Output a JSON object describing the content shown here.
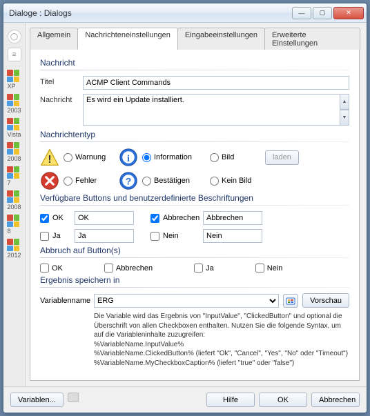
{
  "window": {
    "title": "Dialoge : Dialogs"
  },
  "tabs": [
    "Allgemein",
    "Nachrichteneinstellungen",
    "Eingabeeinstellungen",
    "Erweiterte Einstellungen"
  ],
  "activeTab": 1,
  "osList": [
    "XP",
    "2003",
    "Vista",
    "2008",
    "7",
    "2008",
    "8",
    "2012"
  ],
  "section": {
    "nachricht": "Nachricht",
    "typ": "Nachrichtentyp",
    "buttons": "Verfügbare Buttons und benutzerdefinierte Beschriftungen",
    "abbruch": "Abbruch auf Button(s)",
    "ergebnis": "Ergebnis speichern in"
  },
  "labels": {
    "titel": "Titel",
    "nachricht": "Nachricht",
    "variablenname": "Variablenname"
  },
  "values": {
    "titel": "ACMP Client Commands",
    "nachricht": "Es wird ein Update installiert."
  },
  "msgtype": {
    "warnung": "Warnung",
    "information": "Information",
    "fehler": "Fehler",
    "bestaetigen": "Bestätigen",
    "bild": "Bild",
    "keinbild": "Kein Bild",
    "laden": "laden",
    "selected": "information"
  },
  "avbuttons": {
    "ok": {
      "label": "OK",
      "checked": true,
      "value": "OK"
    },
    "abbrechen": {
      "label": "Abbrechen",
      "checked": true,
      "value": "Abbrechen"
    },
    "ja": {
      "label": "Ja",
      "checked": false,
      "value": "Ja"
    },
    "nein": {
      "label": "Nein",
      "checked": false,
      "value": "Nein"
    }
  },
  "cancelOn": {
    "ok": {
      "label": "OK",
      "checked": false
    },
    "abbrechen": {
      "label": "Abbrechen",
      "checked": false
    },
    "ja": {
      "label": "Ja",
      "checked": false
    },
    "nein": {
      "label": "Nein",
      "checked": false
    }
  },
  "result": {
    "variable": "ERG",
    "vorschau": "Vorschau"
  },
  "helptext": "Die Variable wird das Ergebnis von \"InputValue\", \"ClickedButton\" und optional die Überschrift von allen Checkboxen enthalten. Nutzen Sie die folgende Syntax, um auf die Variableninhalte zuzugreifen:\n%VariableName.InputValue%\n%VariableName.ClickedButton% (liefert \"Ok\", \"Cancel\", \"Yes\", \"No\" oder \"Timeout\")\n%VariableName.MyCheckboxCaption% (liefert \"true\" oder \"false\")",
  "footer": {
    "variablen": "Variablen...",
    "hilfe": "Hilfe",
    "ok": "OK",
    "abbrechen": "Abbrechen"
  }
}
